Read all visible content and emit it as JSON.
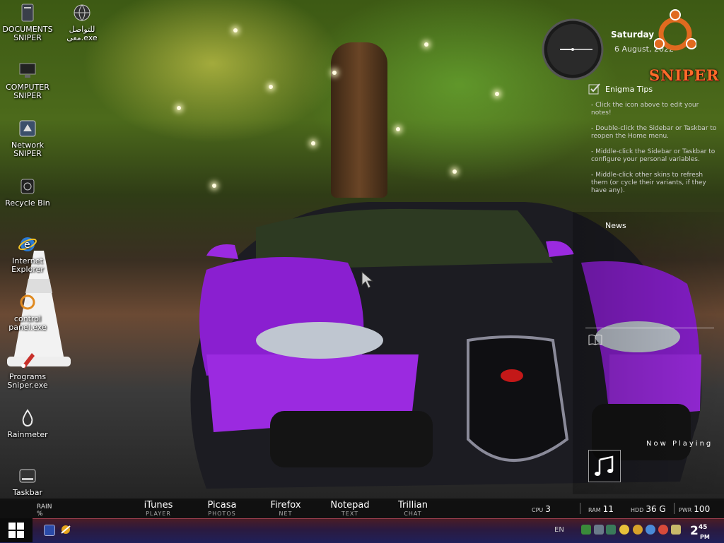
{
  "desktop_icons": [
    {
      "label": "DOCUMENTS SNIPER",
      "icon": "documents-icon"
    },
    {
      "label": "للتواصل معى.exe",
      "icon": "globe-icon"
    },
    {
      "label": "COMPUTER SNIPER",
      "icon": "computer-icon"
    },
    {
      "label": "Network SNIPER",
      "icon": "network-icon"
    },
    {
      "label": "Recycle Bin",
      "icon": "recycle-bin-icon"
    },
    {
      "label": "Internet Explorer",
      "icon": "internet-explorer-icon"
    },
    {
      "label": "control panel.exe",
      "icon": "control-panel-icon"
    },
    {
      "label": "Programs Sniper.exe",
      "icon": "programs-icon"
    },
    {
      "label": "Rainmeter",
      "icon": "rainmeter-icon"
    },
    {
      "label": "Taskbar",
      "icon": "taskbar-icon"
    }
  ],
  "clock_widget": {
    "day": "Saturday",
    "date": "6 August, 2022",
    "hour_hand_deg": 270,
    "minute_hand_deg": 90
  },
  "logo_text": "SNIPER",
  "notes": {
    "title": "Enigma Tips",
    "tips": [
      "- Click the icon above to edit your notes!",
      "- Double-click the Sidebar or Taskbar to reopen the Home menu.",
      "- Middle-click the Sidebar or Taskbar to configure your personal variables.",
      "- Middle-click other skins to refresh them (or cycle their variants, if they have any)."
    ]
  },
  "news_label": "News",
  "now_playing_label": "Now Playing",
  "status_bar": {
    "rain_label": "RAIN",
    "rain_value": "%",
    "launchers": [
      {
        "title": "iTunes",
        "sub": "PLAYER"
      },
      {
        "title": "Picasa",
        "sub": "PHOTOS"
      },
      {
        "title": "Firefox",
        "sub": "NET"
      },
      {
        "title": "Notepad",
        "sub": "TEXT"
      },
      {
        "title": "Trillian",
        "sub": "CHAT"
      }
    ],
    "stats": [
      {
        "key": "CPU",
        "value": "3"
      },
      {
        "key": "RAM",
        "value": "11"
      },
      {
        "key": "HDD",
        "value": "36 G"
      },
      {
        "key": "PWR",
        "value": "100"
      }
    ]
  },
  "taskbar": {
    "language": "EN",
    "time_hour": "2",
    "time_min": "45",
    "time_ampm": "PM"
  }
}
